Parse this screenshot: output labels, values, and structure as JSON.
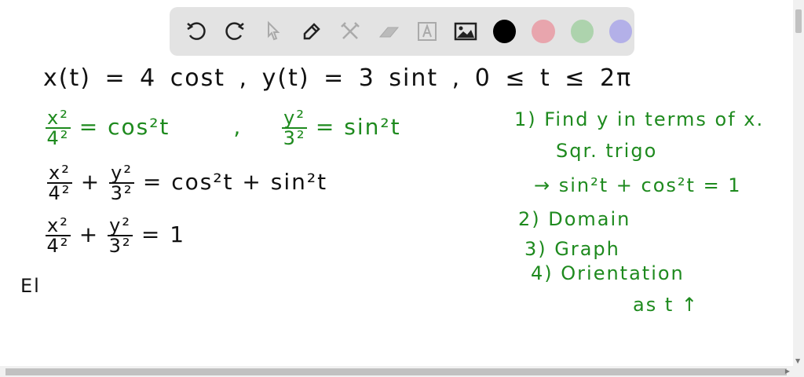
{
  "toolbar": {
    "tools": [
      "undo-icon",
      "redo-icon",
      "select-icon",
      "pen-icon",
      "tools-icon",
      "eraser-icon",
      "text-icon",
      "image-icon"
    ],
    "colors": [
      "#000000",
      "#e8a5ad",
      "#add3ad",
      "#b3b0e8"
    ]
  },
  "board": {
    "line1": "x(t) = 4 cost   ,   y(t) = 3 sint   ,   0 ≤ t ≤ 2π",
    "line2": {
      "f1n": "x²",
      "f1d": "4²",
      "r1": "= cos²t",
      "sep": ",",
      "f2n": "y²",
      "f2d": "3²",
      "r2": "= sin²t"
    },
    "line3": {
      "f1n": "x²",
      "f1d": "4²",
      "plus": "+",
      "f2n": "y²",
      "f2d": "3²",
      "r": "= cos²t + sin²t"
    },
    "line4": {
      "f1n": "x²",
      "f1d": "4²",
      "plus": "+",
      "f2n": "y²",
      "f2d": "3²",
      "r": "= 1"
    },
    "line5": "El",
    "steps": [
      "1) Find y in terms of x.",
      "Sqr. trigo",
      "→ sin²t + cos²t = 1",
      "2) Domain",
      "3) Graph",
      "4) Orientation",
      "as t ↑"
    ]
  }
}
